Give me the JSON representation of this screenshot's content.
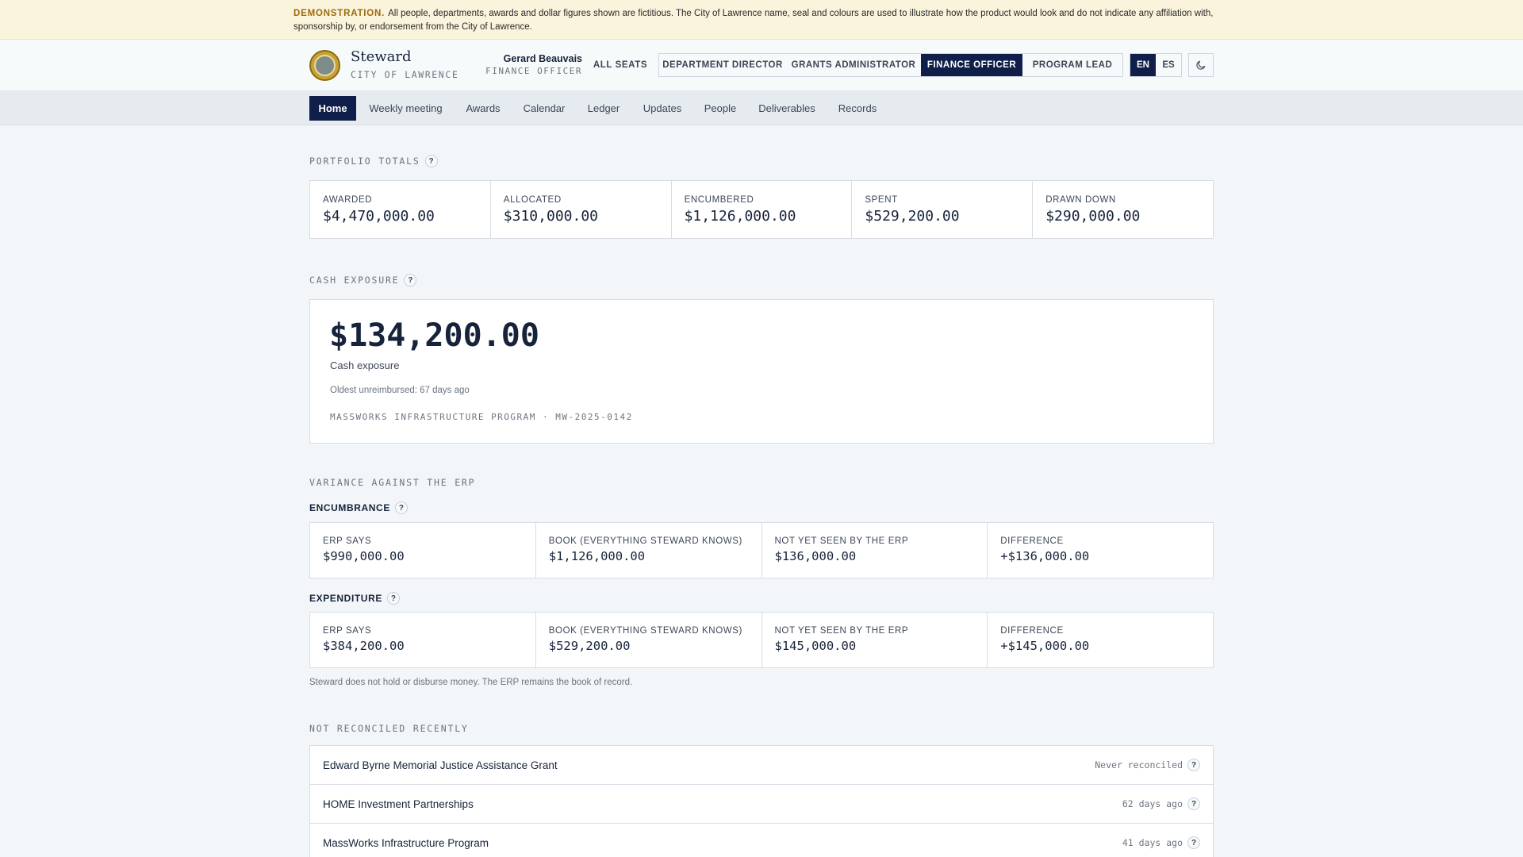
{
  "banner": {
    "tag": "DEMONSTRATION.",
    "text": "All people, departments, awards and dollar figures shown are fictitious. The City of Lawrence name, seal and colours are used to illustrate how the product would look and do not indicate any affiliation with, sponsorship by, or endorsement from the City of Lawrence."
  },
  "brand": {
    "name": "Steward",
    "subtitle": "CITY OF LAWRENCE"
  },
  "user": {
    "name": "Gerard Beauvais",
    "role": "FINANCE OFFICER"
  },
  "seats": {
    "all_label": "ALL SEATS",
    "items": [
      {
        "label": "DEPARTMENT DIRECTOR",
        "active": false
      },
      {
        "label": "GRANTS ADMINISTRATOR",
        "active": false
      },
      {
        "label": "FINANCE OFFICER",
        "active": true
      },
      {
        "label": "PROGRAM LEAD",
        "active": false
      }
    ]
  },
  "languages": [
    {
      "label": "EN",
      "active": true
    },
    {
      "label": "ES",
      "active": false
    }
  ],
  "theme_icon": "moon-icon",
  "nav": [
    {
      "label": "Home",
      "active": true
    },
    {
      "label": "Weekly meeting",
      "active": false
    },
    {
      "label": "Awards",
      "active": false
    },
    {
      "label": "Calendar",
      "active": false
    },
    {
      "label": "Ledger",
      "active": false
    },
    {
      "label": "Updates",
      "active": false
    },
    {
      "label": "People",
      "active": false
    },
    {
      "label": "Deliverables",
      "active": false
    },
    {
      "label": "Records",
      "active": false
    }
  ],
  "portfolio": {
    "title": "PORTFOLIO TOTALS",
    "items": [
      {
        "label": "AWARDED",
        "value": "$4,470,000.00"
      },
      {
        "label": "ALLOCATED",
        "value": "$310,000.00"
      },
      {
        "label": "ENCUMBERED",
        "value": "$1,126,000.00"
      },
      {
        "label": "SPENT",
        "value": "$529,200.00"
      },
      {
        "label": "DRAWN DOWN",
        "value": "$290,000.00"
      }
    ]
  },
  "cash": {
    "title": "CASH EXPOSURE",
    "amount": "$134,200.00",
    "label": "Cash exposure",
    "oldest": "Oldest unreimbursed: 67 days ago",
    "program": "MASSWORKS INFRASTRUCTURE PROGRAM · MW-2025-0142"
  },
  "variance": {
    "title": "VARIANCE AGAINST THE ERP",
    "encumbrance": {
      "title": "ENCUMBRANCE",
      "cells": [
        {
          "label": "ERP SAYS",
          "value": "$990,000.00"
        },
        {
          "label": "BOOK (EVERYTHING STEWARD KNOWS)",
          "value": "$1,126,000.00"
        },
        {
          "label": "NOT YET SEEN BY THE ERP",
          "value": "$136,000.00"
        },
        {
          "label": "DIFFERENCE",
          "value": "+$136,000.00"
        }
      ]
    },
    "expenditure": {
      "title": "EXPENDITURE",
      "cells": [
        {
          "label": "ERP SAYS",
          "value": "$384,200.00"
        },
        {
          "label": "BOOK (EVERYTHING STEWARD KNOWS)",
          "value": "$529,200.00"
        },
        {
          "label": "NOT YET SEEN BY THE ERP",
          "value": "$145,000.00"
        },
        {
          "label": "DIFFERENCE",
          "value": "+$145,000.00"
        }
      ]
    },
    "note": "Steward does not hold or disburse money. The ERP remains the book of record."
  },
  "reconciled": {
    "title": "NOT RECONCILED RECENTLY",
    "items": [
      {
        "name": "Edward Byrne Memorial Justice Assistance Grant",
        "status": "Never reconciled"
      },
      {
        "name": "HOME Investment Partnerships",
        "status": "62 days ago"
      },
      {
        "name": "MassWorks Infrastructure Program",
        "status": "41 days ago"
      }
    ]
  },
  "help_glyph": "?"
}
